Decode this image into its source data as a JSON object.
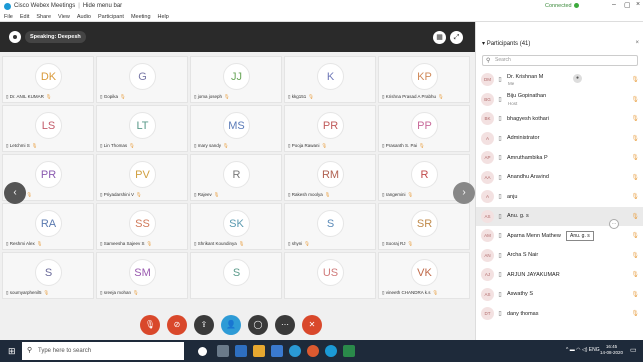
{
  "window": {
    "title": "Cisco Webex Meetings",
    "hide_menu": "Hide menu bar",
    "connection": "Connected",
    "minimize": "–",
    "maximize": "▢",
    "close": "×"
  },
  "menu": [
    "File",
    "Edit",
    "Share",
    "View",
    "Audio",
    "Participant",
    "Meeting",
    "Help"
  ],
  "speaker": {
    "label": "Speaking: Deepesh"
  },
  "tiles": [
    {
      "initials": "DK",
      "name": "Dr. ANIL KUMAR",
      "color": "#d99a3b"
    },
    {
      "initials": "G",
      "name": "Gopika",
      "color": "#7a7aa8"
    },
    {
      "initials": "JJ",
      "name": "joma joseph",
      "color": "#6aa65a"
    },
    {
      "initials": "K",
      "name": "kkg151",
      "color": "#6e78b8"
    },
    {
      "initials": "KP",
      "name": "Krishna Prasad A Prabhu",
      "color": "#d08a5a"
    },
    {
      "initials": "LS",
      "name": "Letchmi S",
      "color": "#c45a6a"
    },
    {
      "initials": "LT",
      "name": "Lin Thomas",
      "color": "#5a9a8a"
    },
    {
      "initials": "MS",
      "name": "mary sandy",
      "color": "#5a7ab8"
    },
    {
      "initials": "PR",
      "name": "Pooja Rawani",
      "color": "#c05a5a"
    },
    {
      "initials": "PP",
      "name": "Prasanth S. Pai",
      "color": "#c86a9a"
    },
    {
      "initials": "PR",
      "name": "Priya R",
      "color": "#8a5ab0"
    },
    {
      "initials": "PV",
      "name": "Priyadarshini V",
      "color": "#d0a040"
    },
    {
      "initials": "R",
      "name": "Rajeev",
      "color": "#777"
    },
    {
      "initials": "RM",
      "name": "Rakesh moolya",
      "color": "#b06050"
    },
    {
      "initials": "R",
      "name": "rangemini",
      "color": "#c04a4a"
    },
    {
      "initials": "RA",
      "name": "Reshmi Alex",
      "color": "#5a7ab0"
    },
    {
      "initials": "SS",
      "name": "Sameesha Sajeev S",
      "color": "#d07a5a"
    },
    {
      "initials": "SK",
      "name": "Shrikant Koundinya",
      "color": "#5a9ab0"
    },
    {
      "initials": "S",
      "name": "shyni",
      "color": "#5a8ab8"
    },
    {
      "initials": "SR",
      "name": "Sooraj RJ",
      "color": "#c08a4a"
    },
    {
      "initials": "S",
      "name": "soumyarphenil5",
      "color": "#6a6a9a"
    },
    {
      "initials": "SM",
      "name": "sreeja mohan",
      "color": "#9a5ab0"
    },
    {
      "initials": "S",
      "name": "",
      "color": "#5a9a8a"
    },
    {
      "initials": "US",
      "name": "",
      "color": "#d07a7a"
    },
    {
      "initials": "VK",
      "name": "vineeth CHANDRA k.s",
      "color": "#c06a4a"
    }
  ],
  "controls": [
    {
      "icon": "mic-muted-icon",
      "glyph": "🎙",
      "color": "#d9482b"
    },
    {
      "icon": "video-off-icon",
      "glyph": "⊘",
      "color": "#d9482b"
    },
    {
      "icon": "share-icon",
      "glyph": "⇪",
      "color": "#3a3a3a"
    },
    {
      "icon": "participants-icon",
      "glyph": "👤",
      "color": "#2e9bd6"
    },
    {
      "icon": "chat-icon",
      "glyph": "◯",
      "color": "#3a3a3a"
    },
    {
      "icon": "more-icon",
      "glyph": "⋯",
      "color": "#3a3a3a"
    },
    {
      "icon": "end-call-icon",
      "glyph": "✕",
      "color": "#d9482b"
    }
  ],
  "panel": {
    "title": "Participants (41)",
    "search_placeholder": "Search",
    "tooltip": "Anu. g. s",
    "participants": [
      {
        "initials": "DM",
        "name": "Dr. Krishnan M",
        "role": "Me"
      },
      {
        "initials": "BG",
        "name": "Biju Gopinathan",
        "role": "Host"
      },
      {
        "initials": "BK",
        "name": "bhagyesh kothari",
        "role": ""
      },
      {
        "initials": "A",
        "name": "Administrator",
        "role": ""
      },
      {
        "initials": "AP",
        "name": "Amruthambika P",
        "role": ""
      },
      {
        "initials": "AA",
        "name": "Anandhu Aravind",
        "role": ""
      },
      {
        "initials": "A",
        "name": "anju",
        "role": ""
      },
      {
        "initials": "AS",
        "name": "Anu. g. s",
        "role": ""
      },
      {
        "initials": "AM",
        "name": "Aparna Menn Mathew",
        "role": ""
      },
      {
        "initials": "AN",
        "name": "Archa S Nair",
        "role": ""
      },
      {
        "initials": "AJ",
        "name": "ARJUN JAYAKUMAR",
        "role": ""
      },
      {
        "initials": "AS",
        "name": "Aswathy S",
        "role": ""
      },
      {
        "initials": "DT",
        "name": "dany thomas",
        "role": ""
      }
    ]
  },
  "taskbar": {
    "search_placeholder": "Type here to search",
    "tray": "ENG",
    "time": "16:45",
    "date": "14-08-2020"
  }
}
